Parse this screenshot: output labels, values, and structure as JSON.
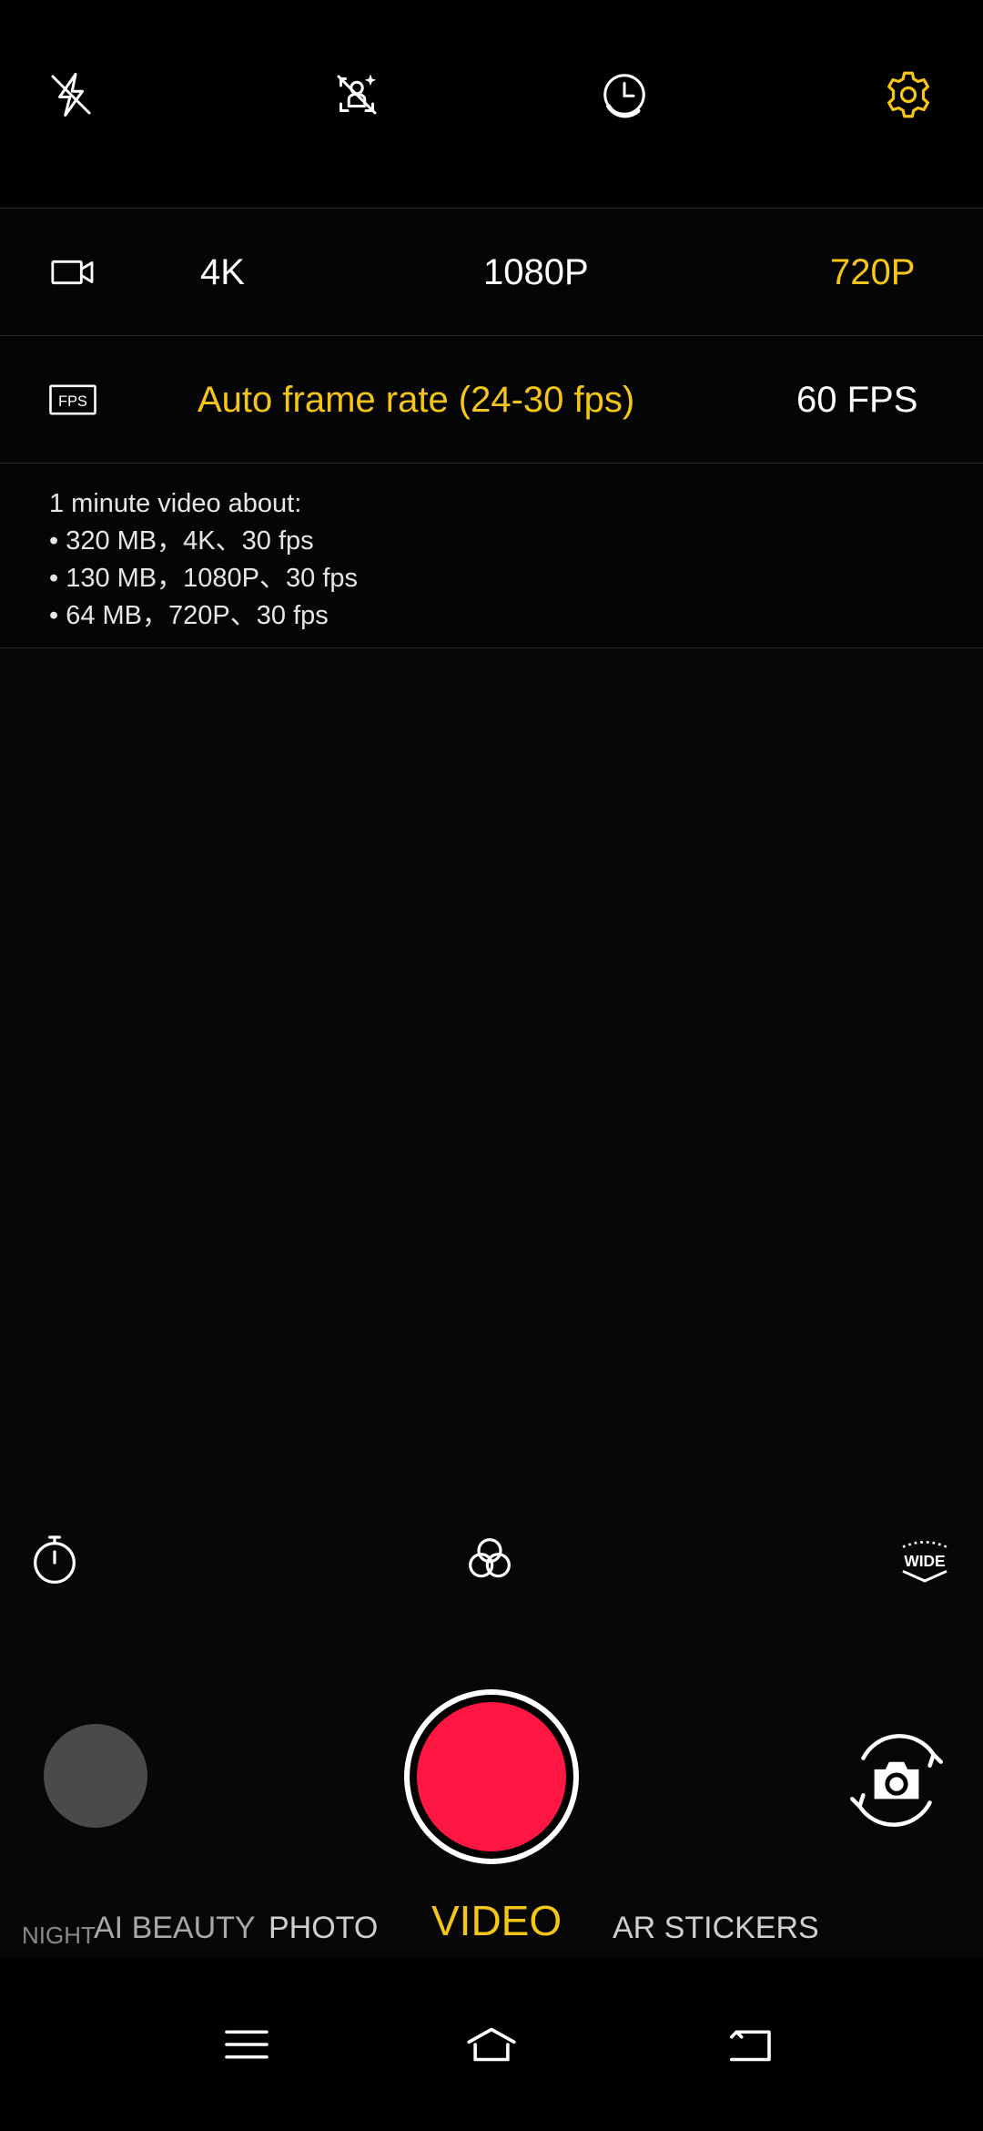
{
  "colors": {
    "accent": "#f5c518",
    "record": "#ff1744",
    "background": "#000000",
    "text": "#ffffff"
  },
  "top_bar": {
    "icons": [
      "flash-off-icon",
      "ai-scene-off-icon",
      "timer-clock-icon",
      "settings-gear-icon"
    ]
  },
  "resolution": {
    "icon": "video-camera-icon",
    "options": [
      "4K",
      "1080P",
      "720P"
    ],
    "selected": "720P"
  },
  "frame_rate": {
    "icon": "fps-icon",
    "icon_text": "FPS",
    "options": [
      "Auto frame rate (24-30 fps)",
      "60 FPS"
    ],
    "selected": "Auto frame rate (24-30 fps)"
  },
  "info": {
    "heading": "1 minute video about:",
    "lines": [
      "• 320 MB，4K、30 fps",
      "• 130 MB，1080P、30 fps",
      "• 64 MB，720P、30 fps"
    ]
  },
  "tools": {
    "icons": [
      "stopwatch-icon",
      "filters-icon",
      "wide-angle-icon"
    ],
    "wide_label": "WIDE"
  },
  "capture": {
    "shutter": "record-button",
    "flip": "switch-camera-icon"
  },
  "modes": {
    "items": [
      "NIGHT",
      "AI BEAUTY",
      "PHOTO",
      "VIDEO",
      "AR STICKERS"
    ],
    "selected": "VIDEO"
  },
  "nav": {
    "icons": [
      "menu-icon",
      "home-icon",
      "back-icon"
    ]
  }
}
